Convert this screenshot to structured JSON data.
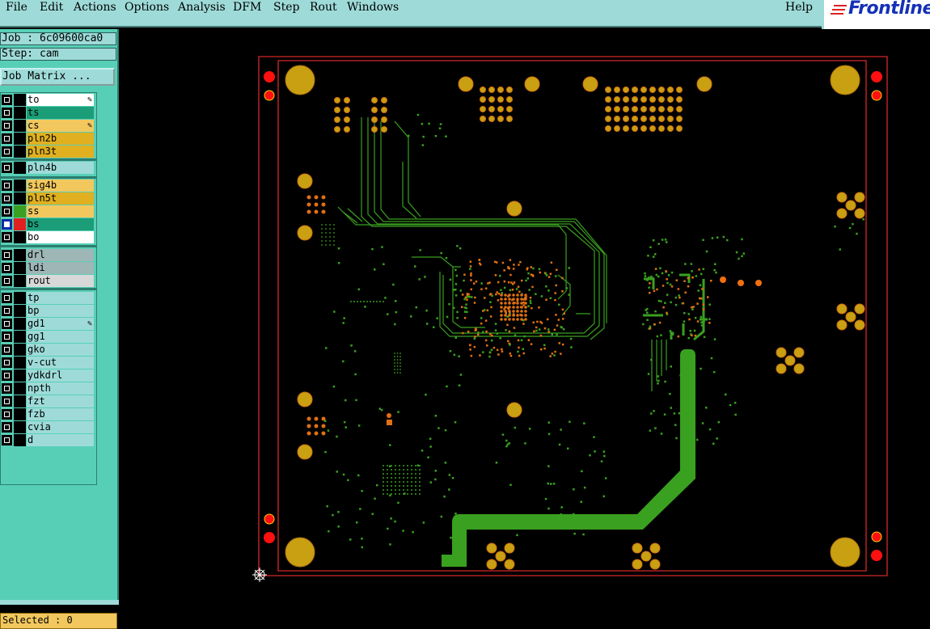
{
  "menu": {
    "file": "File",
    "edit": "Edit",
    "actions": "Actions",
    "options": "Options",
    "analysis": "Analysis",
    "dfm": "DFM",
    "step": "Step",
    "rout": "Rout",
    "windows": "Windows",
    "help": "Help"
  },
  "logo": "Frontline",
  "job_label": "Job : 6c09600ca0",
  "step_label": "Step: cam",
  "job_matrix_button": "Job Matrix ...",
  "layers": [
    {
      "name": "to",
      "color": "#ffffff",
      "swatch": "#000000",
      "checked": false,
      "marked": true
    },
    {
      "name": "ts",
      "color": "#1b9e78",
      "swatch": "#000000",
      "checked": false,
      "marked": false
    },
    {
      "name": "cs",
      "color": "#f2c85e",
      "swatch": "#000000",
      "checked": false,
      "marked": true
    },
    {
      "name": "pln2b",
      "color": "#e0b020",
      "swatch": "#000000",
      "checked": false,
      "marked": false
    },
    {
      "name": "pln3t",
      "color": "#e0b020",
      "swatch": "#000000",
      "checked": false,
      "marked": false
    },
    {
      "name": "pln4b",
      "color": "#9edbd8",
      "swatch": "#000000",
      "checked": false,
      "marked": false
    },
    {
      "name": "sig4b",
      "color": "#f2c85e",
      "swatch": "#000000",
      "checked": false,
      "marked": false
    },
    {
      "name": "pln5t",
      "color": "#e0b020",
      "swatch": "#000000",
      "checked": false,
      "marked": false
    },
    {
      "name": "ss",
      "color": "#f2c85e",
      "swatch": "#3aa020",
      "checked": false,
      "marked": false
    },
    {
      "name": "bs",
      "color": "#1b9e78",
      "swatch": "#e02020",
      "checked": true,
      "marked": false
    },
    {
      "name": "bo",
      "color": "#ffffff",
      "swatch": "#000000",
      "checked": false,
      "marked": false
    },
    {
      "name": "drl",
      "color": "#9fb6b6",
      "swatch": "#000000",
      "checked": false,
      "marked": false
    },
    {
      "name": "ldi",
      "color": "#9fb6b6",
      "swatch": "#000000",
      "checked": false,
      "marked": false
    },
    {
      "name": "rout",
      "color": "#d8d8d8",
      "swatch": "#000000",
      "checked": false,
      "marked": false
    },
    {
      "name": "tp",
      "color": "#9edbd8",
      "swatch": "#000000",
      "checked": false,
      "marked": false
    },
    {
      "name": "bp",
      "color": "#9edbd8",
      "swatch": "#000000",
      "checked": false,
      "marked": false
    },
    {
      "name": "gd1",
      "color": "#9edbd8",
      "swatch": "#000000",
      "checked": false,
      "marked": true
    },
    {
      "name": "gg1",
      "color": "#9edbd8",
      "swatch": "#000000",
      "checked": false,
      "marked": false
    },
    {
      "name": "gko",
      "color": "#9edbd8",
      "swatch": "#000000",
      "checked": false,
      "marked": false
    },
    {
      "name": "v-cut",
      "color": "#9edbd8",
      "swatch": "#000000",
      "checked": false,
      "marked": false
    },
    {
      "name": "ydkdrl",
      "color": "#9edbd8",
      "swatch": "#000000",
      "checked": false,
      "marked": false
    },
    {
      "name": "npth",
      "color": "#9edbd8",
      "swatch": "#000000",
      "checked": false,
      "marked": false
    },
    {
      "name": "fzt",
      "color": "#9edbd8",
      "swatch": "#000000",
      "checked": false,
      "marked": false
    },
    {
      "name": "fzb",
      "color": "#9edbd8",
      "swatch": "#000000",
      "checked": false,
      "marked": false
    },
    {
      "name": "cvia",
      "color": "#9edbd8",
      "swatch": "#000000",
      "checked": false,
      "marked": false
    },
    {
      "name": "d",
      "color": "#9edbd8",
      "swatch": "#000000",
      "checked": false,
      "marked": false
    }
  ],
  "status": "Selected : 0",
  "colors": {
    "menu_bg": "#9edbd8",
    "panel_bg": "#57cfb6",
    "board_outline": "#d42828",
    "pad": "#c8a012",
    "trace": "#3aa020",
    "fiducial": "#ff1010"
  }
}
